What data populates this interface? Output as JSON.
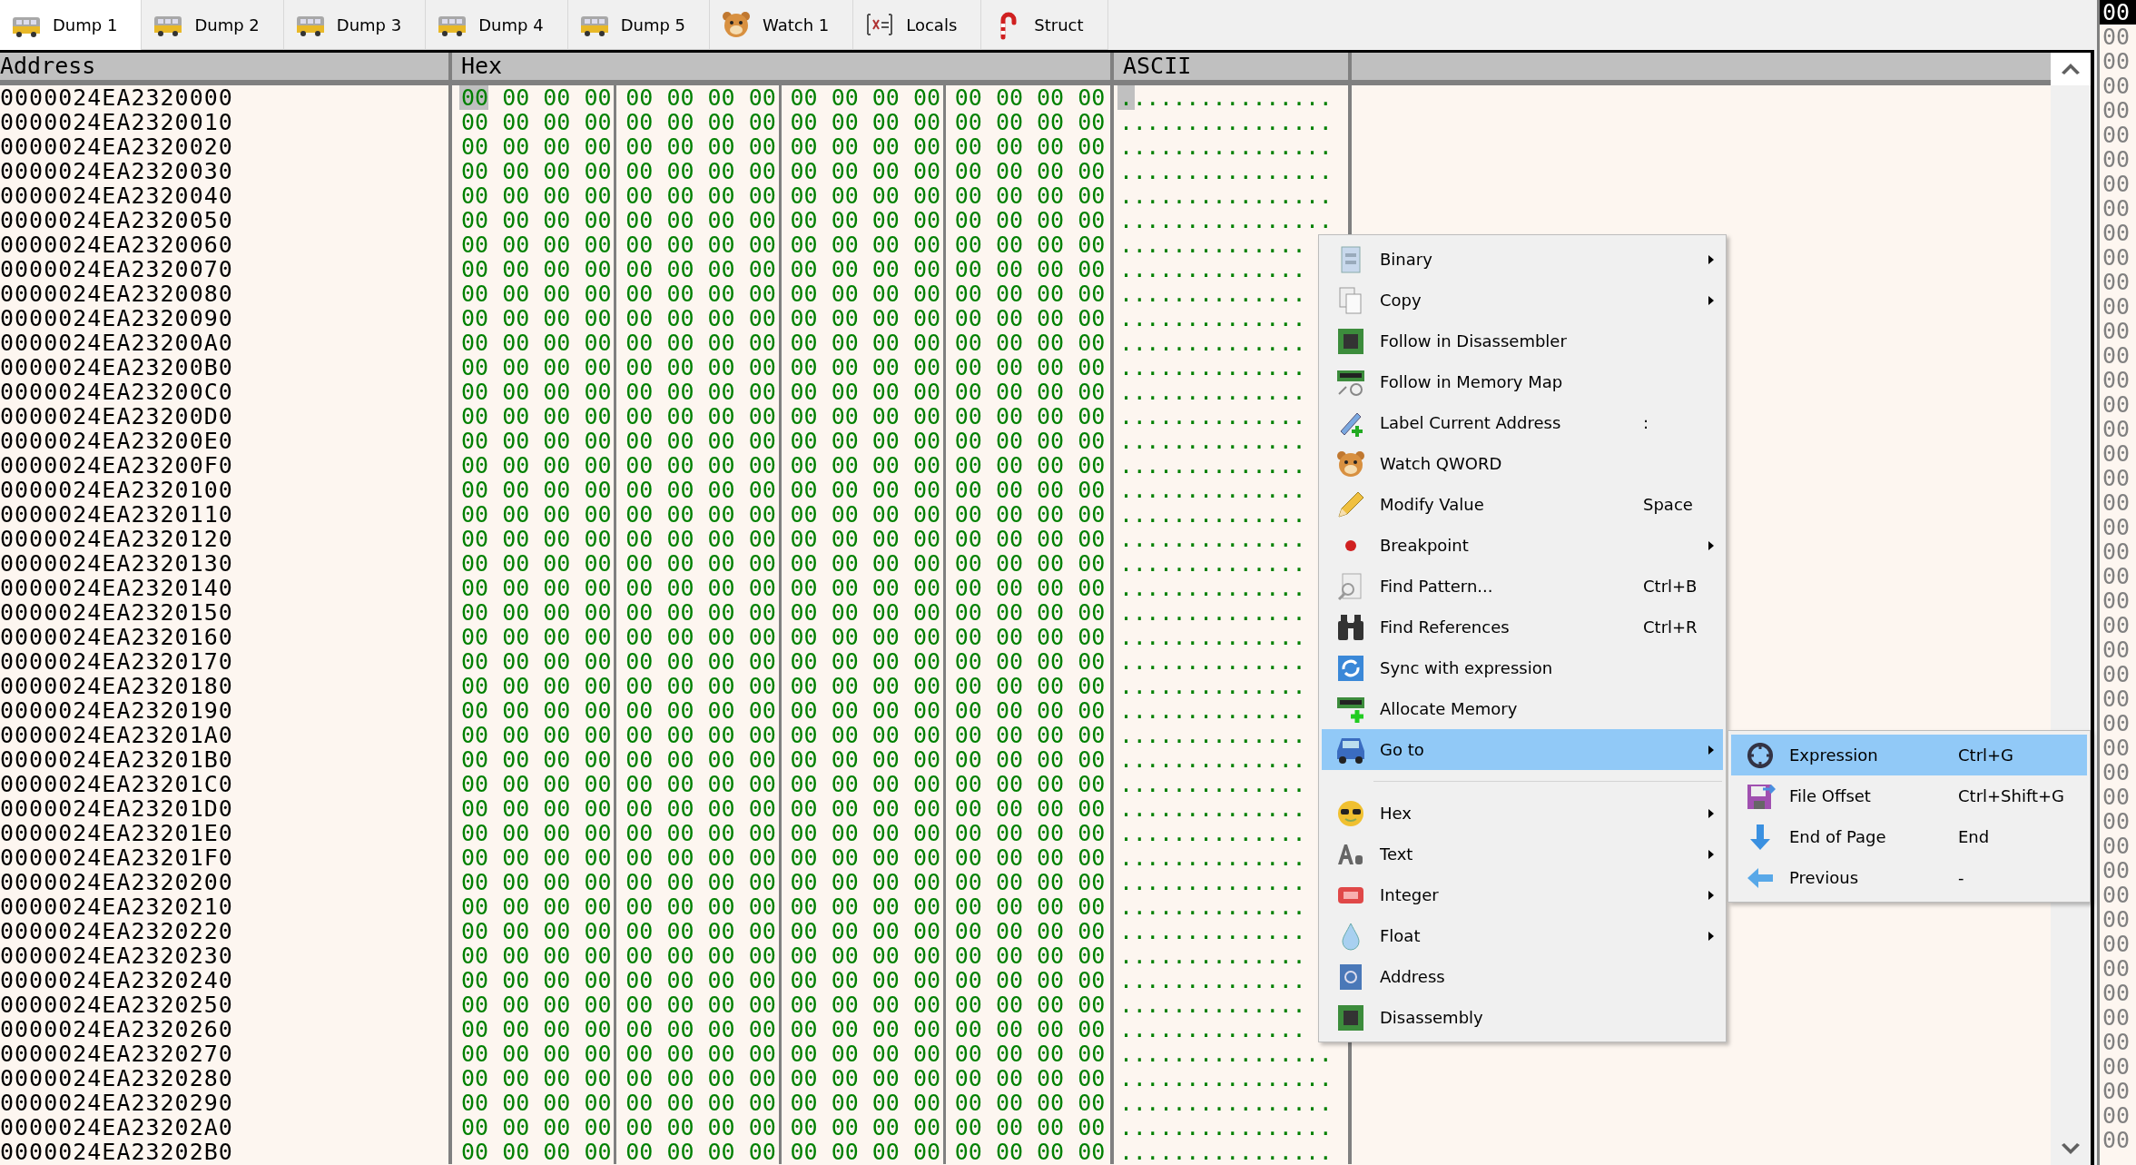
{
  "tabs": [
    {
      "label": "Dump 1",
      "selected": true
    },
    {
      "label": "Dump 2",
      "selected": false
    },
    {
      "label": "Dump 3",
      "selected": false
    },
    {
      "label": "Dump 4",
      "selected": false
    },
    {
      "label": "Dump 5",
      "selected": false
    },
    {
      "label": "Watch 1",
      "selected": false
    },
    {
      "label": "Locals",
      "selected": false
    },
    {
      "label": "Struct",
      "selected": false
    }
  ],
  "dump": {
    "columns": [
      "Address",
      "Hex",
      "ASCII"
    ],
    "rows": [
      {
        "address": "0000024EA2320000",
        "hex": [
          "00 00 00 00",
          "00 00 00 00",
          "00 00 00 00",
          "00 00 00 00"
        ],
        "ascii": "................",
        "selected": true
      },
      {
        "address": "0000024EA2320010",
        "hex": [
          "00 00 00 00",
          "00 00 00 00",
          "00 00 00 00",
          "00 00 00 00"
        ],
        "ascii": "................",
        "selected": false
      },
      {
        "address": "0000024EA2320020",
        "hex": [
          "00 00 00 00",
          "00 00 00 00",
          "00 00 00 00",
          "00 00 00 00"
        ],
        "ascii": "................",
        "selected": false
      },
      {
        "address": "0000024EA2320030",
        "hex": [
          "00 00 00 00",
          "00 00 00 00",
          "00 00 00 00",
          "00 00 00 00"
        ],
        "ascii": "................",
        "selected": false
      },
      {
        "address": "0000024EA2320040",
        "hex": [
          "00 00 00 00",
          "00 00 00 00",
          "00 00 00 00",
          "00 00 00 00"
        ],
        "ascii": "................",
        "selected": false
      },
      {
        "address": "0000024EA2320050",
        "hex": [
          "00 00 00 00",
          "00 00 00 00",
          "00 00 00 00",
          "00 00 00 00"
        ],
        "ascii": "................",
        "selected": false
      },
      {
        "address": "0000024EA2320060",
        "hex": [
          "00 00 00 00",
          "00 00 00 00",
          "00 00 00 00",
          "00 00 00 00"
        ],
        "ascii": "..............",
        "selected": false
      },
      {
        "address": "0000024EA2320070",
        "hex": [
          "00 00 00 00",
          "00 00 00 00",
          "00 00 00 00",
          "00 00 00 00"
        ],
        "ascii": "..............",
        "selected": false
      },
      {
        "address": "0000024EA2320080",
        "hex": [
          "00 00 00 00",
          "00 00 00 00",
          "00 00 00 00",
          "00 00 00 00"
        ],
        "ascii": "..............",
        "selected": false
      },
      {
        "address": "0000024EA2320090",
        "hex": [
          "00 00 00 00",
          "00 00 00 00",
          "00 00 00 00",
          "00 00 00 00"
        ],
        "ascii": "..............",
        "selected": false
      },
      {
        "address": "0000024EA23200A0",
        "hex": [
          "00 00 00 00",
          "00 00 00 00",
          "00 00 00 00",
          "00 00 00 00"
        ],
        "ascii": "..............",
        "selected": false
      },
      {
        "address": "0000024EA23200B0",
        "hex": [
          "00 00 00 00",
          "00 00 00 00",
          "00 00 00 00",
          "00 00 00 00"
        ],
        "ascii": "..............",
        "selected": false
      },
      {
        "address": "0000024EA23200C0",
        "hex": [
          "00 00 00 00",
          "00 00 00 00",
          "00 00 00 00",
          "00 00 00 00"
        ],
        "ascii": "..............",
        "selected": false
      },
      {
        "address": "0000024EA23200D0",
        "hex": [
          "00 00 00 00",
          "00 00 00 00",
          "00 00 00 00",
          "00 00 00 00"
        ],
        "ascii": "..............",
        "selected": false
      },
      {
        "address": "0000024EA23200E0",
        "hex": [
          "00 00 00 00",
          "00 00 00 00",
          "00 00 00 00",
          "00 00 00 00"
        ],
        "ascii": "..............",
        "selected": false
      },
      {
        "address": "0000024EA23200F0",
        "hex": [
          "00 00 00 00",
          "00 00 00 00",
          "00 00 00 00",
          "00 00 00 00"
        ],
        "ascii": "..............",
        "selected": false
      },
      {
        "address": "0000024EA2320100",
        "hex": [
          "00 00 00 00",
          "00 00 00 00",
          "00 00 00 00",
          "00 00 00 00"
        ],
        "ascii": "..............",
        "selected": false
      },
      {
        "address": "0000024EA2320110",
        "hex": [
          "00 00 00 00",
          "00 00 00 00",
          "00 00 00 00",
          "00 00 00 00"
        ],
        "ascii": "..............",
        "selected": false
      },
      {
        "address": "0000024EA2320120",
        "hex": [
          "00 00 00 00",
          "00 00 00 00",
          "00 00 00 00",
          "00 00 00 00"
        ],
        "ascii": "..............",
        "selected": false
      },
      {
        "address": "0000024EA2320130",
        "hex": [
          "00 00 00 00",
          "00 00 00 00",
          "00 00 00 00",
          "00 00 00 00"
        ],
        "ascii": "..............",
        "selected": false
      },
      {
        "address": "0000024EA2320140",
        "hex": [
          "00 00 00 00",
          "00 00 00 00",
          "00 00 00 00",
          "00 00 00 00"
        ],
        "ascii": "..............",
        "selected": false
      },
      {
        "address": "0000024EA2320150",
        "hex": [
          "00 00 00 00",
          "00 00 00 00",
          "00 00 00 00",
          "00 00 00 00"
        ],
        "ascii": "..............",
        "selected": false
      },
      {
        "address": "0000024EA2320160",
        "hex": [
          "00 00 00 00",
          "00 00 00 00",
          "00 00 00 00",
          "00 00 00 00"
        ],
        "ascii": "..............",
        "selected": false
      },
      {
        "address": "0000024EA2320170",
        "hex": [
          "00 00 00 00",
          "00 00 00 00",
          "00 00 00 00",
          "00 00 00 00"
        ],
        "ascii": "..............",
        "selected": false
      },
      {
        "address": "0000024EA2320180",
        "hex": [
          "00 00 00 00",
          "00 00 00 00",
          "00 00 00 00",
          "00 00 00 00"
        ],
        "ascii": "..............",
        "selected": false
      },
      {
        "address": "0000024EA2320190",
        "hex": [
          "00 00 00 00",
          "00 00 00 00",
          "00 00 00 00",
          "00 00 00 00"
        ],
        "ascii": "..............",
        "selected": false
      },
      {
        "address": "0000024EA23201A0",
        "hex": [
          "00 00 00 00",
          "00 00 00 00",
          "00 00 00 00",
          "00 00 00 00"
        ],
        "ascii": "..............",
        "selected": false
      },
      {
        "address": "0000024EA23201B0",
        "hex": [
          "00 00 00 00",
          "00 00 00 00",
          "00 00 00 00",
          "00 00 00 00"
        ],
        "ascii": "..............",
        "selected": false
      },
      {
        "address": "0000024EA23201C0",
        "hex": [
          "00 00 00 00",
          "00 00 00 00",
          "00 00 00 00",
          "00 00 00 00"
        ],
        "ascii": "..............",
        "selected": false
      },
      {
        "address": "0000024EA23201D0",
        "hex": [
          "00 00 00 00",
          "00 00 00 00",
          "00 00 00 00",
          "00 00 00 00"
        ],
        "ascii": "..............",
        "selected": false
      },
      {
        "address": "0000024EA23201E0",
        "hex": [
          "00 00 00 00",
          "00 00 00 00",
          "00 00 00 00",
          "00 00 00 00"
        ],
        "ascii": "..............",
        "selected": false
      },
      {
        "address": "0000024EA23201F0",
        "hex": [
          "00 00 00 00",
          "00 00 00 00",
          "00 00 00 00",
          "00 00 00 00"
        ],
        "ascii": "..............",
        "selected": false
      },
      {
        "address": "0000024EA2320200",
        "hex": [
          "00 00 00 00",
          "00 00 00 00",
          "00 00 00 00",
          "00 00 00 00"
        ],
        "ascii": "..............",
        "selected": false
      },
      {
        "address": "0000024EA2320210",
        "hex": [
          "00 00 00 00",
          "00 00 00 00",
          "00 00 00 00",
          "00 00 00 00"
        ],
        "ascii": "..............",
        "selected": false
      },
      {
        "address": "0000024EA2320220",
        "hex": [
          "00 00 00 00",
          "00 00 00 00",
          "00 00 00 00",
          "00 00 00 00"
        ],
        "ascii": "..............",
        "selected": false
      },
      {
        "address": "0000024EA2320230",
        "hex": [
          "00 00 00 00",
          "00 00 00 00",
          "00 00 00 00",
          "00 00 00 00"
        ],
        "ascii": "..............",
        "selected": false
      },
      {
        "address": "0000024EA2320240",
        "hex": [
          "00 00 00 00",
          "00 00 00 00",
          "00 00 00 00",
          "00 00 00 00"
        ],
        "ascii": "..............",
        "selected": false
      },
      {
        "address": "0000024EA2320250",
        "hex": [
          "00 00 00 00",
          "00 00 00 00",
          "00 00 00 00",
          "00 00 00 00"
        ],
        "ascii": "..............",
        "selected": false
      },
      {
        "address": "0000024EA2320260",
        "hex": [
          "00 00 00 00",
          "00 00 00 00",
          "00 00 00 00",
          "00 00 00 00"
        ],
        "ascii": "..............",
        "selected": false
      },
      {
        "address": "0000024EA2320270",
        "hex": [
          "00 00 00 00",
          "00 00 00 00",
          "00 00 00 00",
          "00 00 00 00"
        ],
        "ascii": "................",
        "selected": false
      },
      {
        "address": "0000024EA2320280",
        "hex": [
          "00 00 00 00",
          "00 00 00 00",
          "00 00 00 00",
          "00 00 00 00"
        ],
        "ascii": "................",
        "selected": false
      },
      {
        "address": "0000024EA2320290",
        "hex": [
          "00 00 00 00",
          "00 00 00 00",
          "00 00 00 00",
          "00 00 00 00"
        ],
        "ascii": "................",
        "selected": false
      },
      {
        "address": "0000024EA23202A0",
        "hex": [
          "00 00 00 00",
          "00 00 00 00",
          "00 00 00 00",
          "00 00 00 00"
        ],
        "ascii": "................",
        "selected": false
      },
      {
        "address": "0000024EA23202B0",
        "hex": [
          "00 00 00 00",
          "00 00 00 00",
          "00 00 00 00",
          "00 00 00 00"
        ],
        "ascii": "................",
        "selected": false
      }
    ]
  },
  "side_pane": {
    "cells": [
      {
        "text": "00",
        "selected": true
      },
      {
        "text": "00",
        "selected": false
      },
      {
        "text": "00",
        "selected": false
      },
      {
        "text": "00",
        "selected": false
      },
      {
        "text": "00",
        "selected": false
      },
      {
        "text": "00",
        "selected": false
      },
      {
        "text": "00",
        "selected": false
      },
      {
        "text": "00",
        "selected": false
      },
      {
        "text": "00",
        "selected": false
      },
      {
        "text": "00",
        "selected": false
      },
      {
        "text": "00",
        "selected": false
      },
      {
        "text": "00",
        "selected": false
      },
      {
        "text": "00",
        "selected": false
      },
      {
        "text": "00",
        "selected": false
      },
      {
        "text": "00",
        "selected": false
      },
      {
        "text": "00",
        "selected": false
      },
      {
        "text": "00",
        "selected": false
      },
      {
        "text": "00",
        "selected": false
      },
      {
        "text": "00",
        "selected": false
      },
      {
        "text": "00",
        "selected": false
      },
      {
        "text": "00",
        "selected": false
      },
      {
        "text": "00",
        "selected": false
      },
      {
        "text": "00",
        "selected": false
      },
      {
        "text": "00",
        "selected": false
      },
      {
        "text": "00",
        "selected": false
      },
      {
        "text": "00",
        "selected": false
      },
      {
        "text": "00",
        "selected": false
      },
      {
        "text": "00",
        "selected": false
      },
      {
        "text": "00",
        "selected": false
      },
      {
        "text": "00",
        "selected": false
      },
      {
        "text": "00",
        "selected": false
      },
      {
        "text": "00",
        "selected": false
      },
      {
        "text": "00",
        "selected": false
      },
      {
        "text": "00",
        "selected": false
      },
      {
        "text": "00",
        "selected": false
      },
      {
        "text": "00",
        "selected": false
      },
      {
        "text": "00",
        "selected": false
      },
      {
        "text": "00",
        "selected": false
      },
      {
        "text": "00",
        "selected": false
      },
      {
        "text": "00",
        "selected": false
      },
      {
        "text": "00",
        "selected": false
      },
      {
        "text": "00",
        "selected": false
      },
      {
        "text": "00",
        "selected": false
      },
      {
        "text": "00",
        "selected": false
      },
      {
        "text": "00",
        "selected": false
      },
      {
        "text": "00",
        "selected": false
      },
      {
        "text": "00",
        "selected": false
      }
    ]
  },
  "context_menu": {
    "items": [
      {
        "kind": "item",
        "label": "Binary",
        "has_submenu": true,
        "selected": false
      },
      {
        "kind": "item",
        "label": "Copy",
        "has_submenu": true,
        "selected": false
      },
      {
        "kind": "item",
        "label": "Follow in Disassembler",
        "has_submenu": false,
        "selected": false
      },
      {
        "kind": "item",
        "label": "Follow in Memory Map",
        "has_submenu": false,
        "selected": false
      },
      {
        "kind": "item",
        "label": "Label Current Address",
        "shortcut": ":",
        "has_submenu": false,
        "selected": false
      },
      {
        "kind": "item",
        "label": "Watch QWORD",
        "has_submenu": false,
        "selected": false
      },
      {
        "kind": "item",
        "label": "Modify Value",
        "shortcut": "Space",
        "has_submenu": false,
        "selected": false
      },
      {
        "kind": "item",
        "label": "Breakpoint",
        "has_submenu": true,
        "selected": false
      },
      {
        "kind": "item",
        "label": "Find Pattern...",
        "shortcut": "Ctrl+B",
        "has_submenu": false,
        "selected": false
      },
      {
        "kind": "item",
        "label": "Find References",
        "shortcut": "Ctrl+R",
        "has_submenu": false,
        "selected": false
      },
      {
        "kind": "item",
        "label": "Sync with expression",
        "has_submenu": false,
        "selected": false
      },
      {
        "kind": "item",
        "label": "Allocate Memory",
        "has_submenu": false,
        "selected": false
      },
      {
        "kind": "item",
        "label": "Go to",
        "has_submenu": true,
        "selected": true
      },
      {
        "kind": "separator"
      },
      {
        "kind": "item",
        "label": "Hex",
        "has_submenu": true,
        "selected": false
      },
      {
        "kind": "item",
        "label": "Text",
        "has_submenu": true,
        "selected": false
      },
      {
        "kind": "item",
        "label": "Integer",
        "has_submenu": true,
        "selected": false
      },
      {
        "kind": "item",
        "label": "Float",
        "has_submenu": true,
        "selected": false
      },
      {
        "kind": "item",
        "label": "Address",
        "has_submenu": false,
        "selected": false
      },
      {
        "kind": "item",
        "label": "Disassembly",
        "has_submenu": false,
        "selected": false
      }
    ]
  },
  "submenu": {
    "items": [
      {
        "label": "Expression",
        "shortcut": "Ctrl+G",
        "selected": true
      },
      {
        "label": "File Offset",
        "shortcut": "Ctrl+Shift+G",
        "selected": false
      },
      {
        "label": "End of Page",
        "shortcut": "End",
        "selected": false
      },
      {
        "label": "Previous",
        "shortcut": "-",
        "selected": false
      }
    ]
  }
}
